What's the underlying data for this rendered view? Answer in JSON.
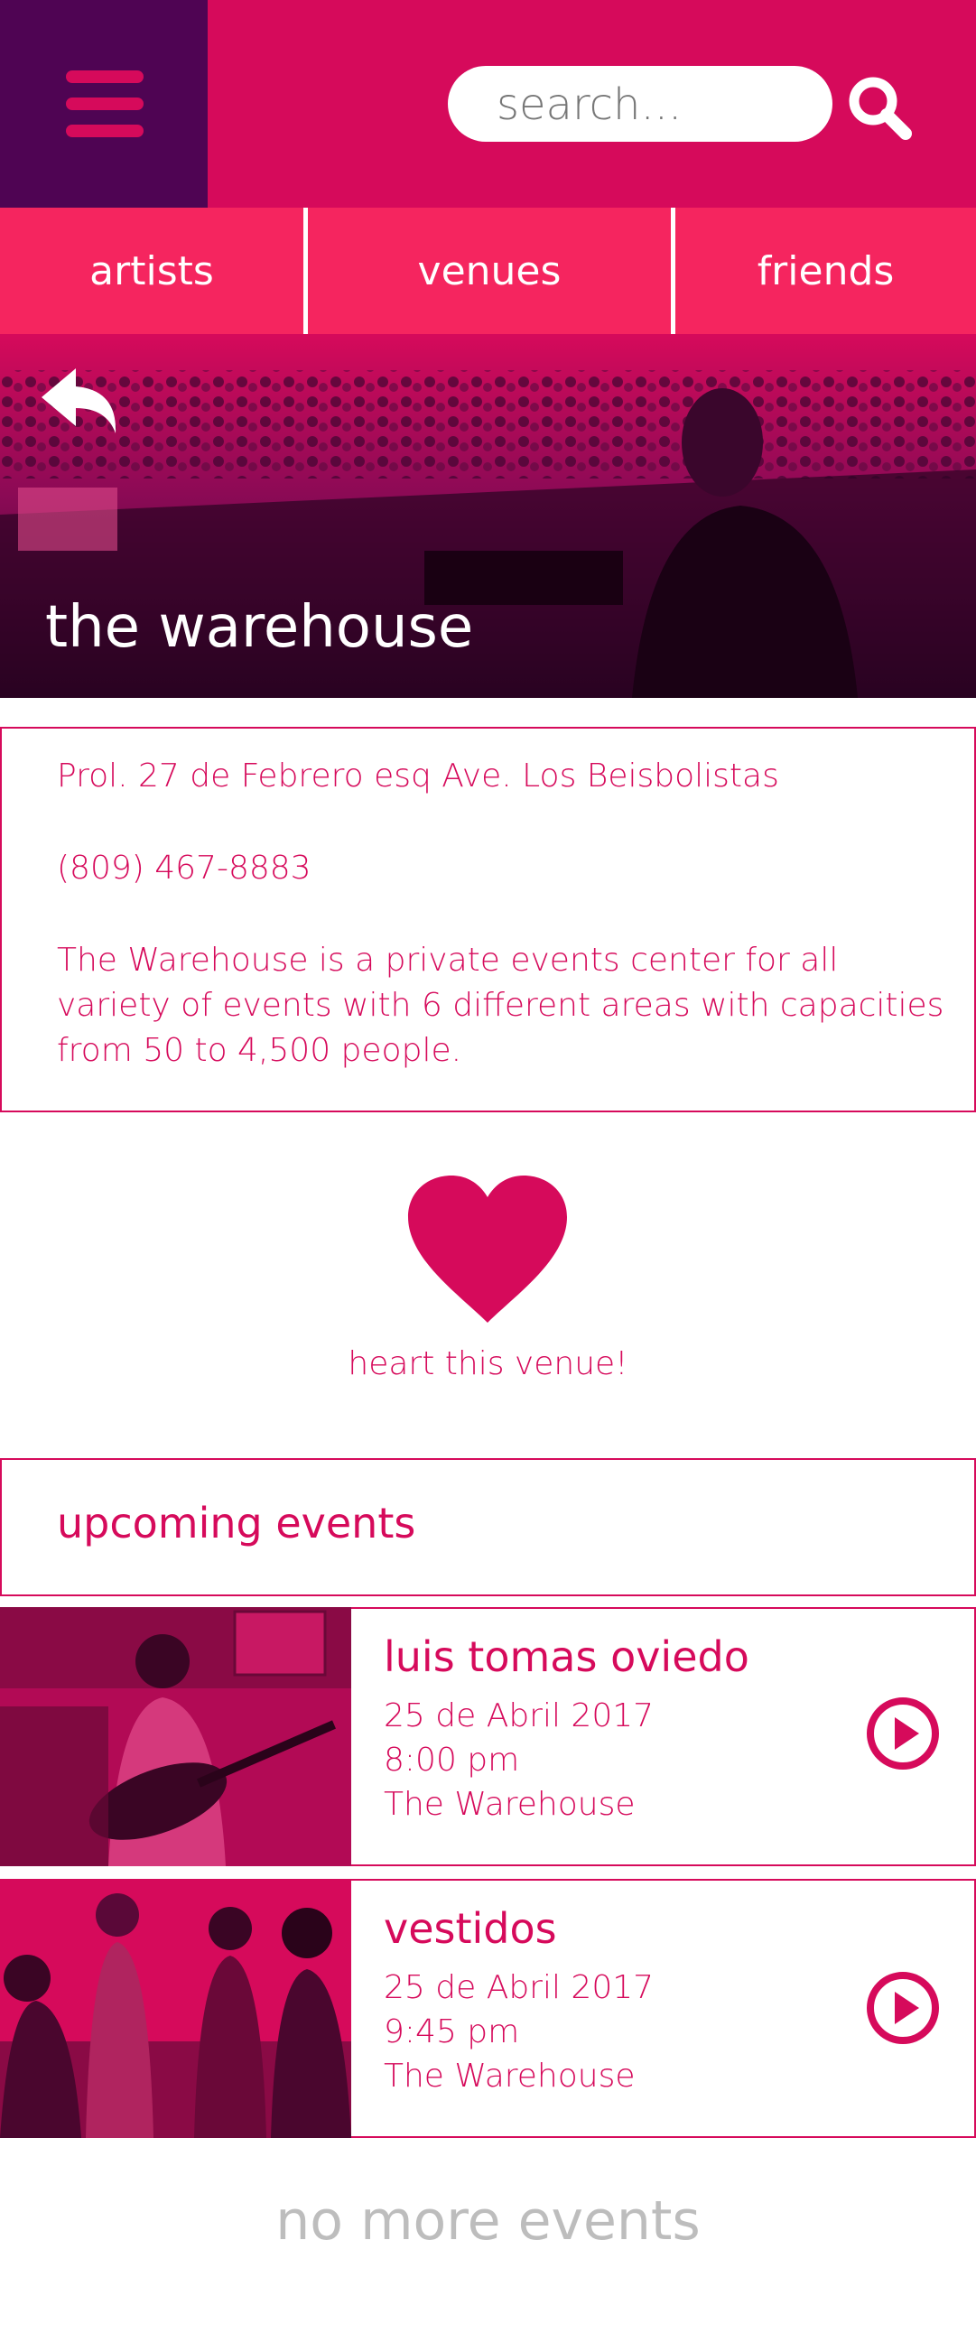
{
  "header": {
    "search_placeholder": "search..."
  },
  "tabs": [
    {
      "label": "artists"
    },
    {
      "label": "venues"
    },
    {
      "label": "friends"
    }
  ],
  "venue": {
    "name": "the warehouse",
    "address": "Prol. 27 de Febrero esq Ave. Los Beisbolistas",
    "phone": "(809) 467-8883",
    "description_lines": [
      "The Warehouse is a private events center for all",
      "variety of events with 6 different areas with capacities",
      "from 50 to 4,500 people."
    ]
  },
  "heart": {
    "label": "heart this venue!"
  },
  "upcoming": {
    "title": "upcoming events",
    "events": [
      {
        "name": "luis tomas oviedo",
        "date": "25 de Abril 2017",
        "time": "8:00 pm",
        "venue": "The Warehouse"
      },
      {
        "name": "vestidos",
        "date": "25 de Abril 2017",
        "time": "9:45 pm",
        "venue": "The Warehouse"
      }
    ]
  },
  "footer": {
    "no_more": "no more events"
  },
  "colors": {
    "primary": "#d60a5b",
    "tab_bg": "#f5255f",
    "menu_bg": "#4f0453",
    "muted": "#bdbdbd"
  },
  "icons": [
    "menu-icon",
    "search-icon",
    "back-arrow-icon",
    "heart-icon",
    "play-icon"
  ]
}
